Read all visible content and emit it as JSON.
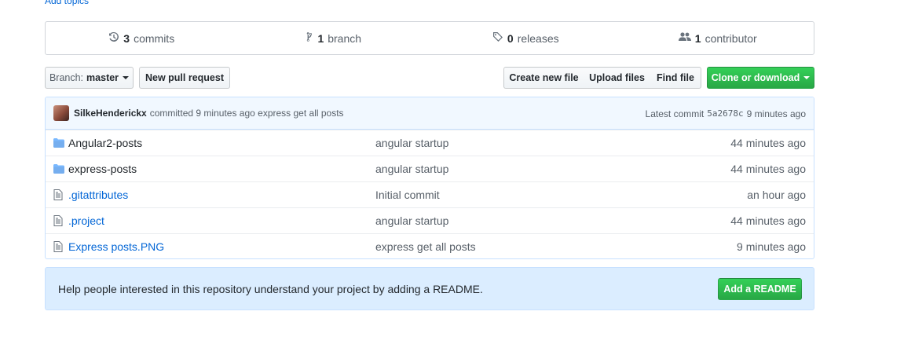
{
  "topics": {
    "add_label": "Add topics"
  },
  "summary": {
    "commits": {
      "count": "3",
      "label": "commits",
      "icon": "history-icon"
    },
    "branches": {
      "count": "1",
      "label": "branch",
      "icon": "branch-icon"
    },
    "releases": {
      "count": "0",
      "label": "releases",
      "icon": "tag-icon"
    },
    "contributors": {
      "count": "1",
      "label": "contributor",
      "icon": "people-icon"
    }
  },
  "toolbar": {
    "branch_prefix": "Branch:",
    "branch_name": "master",
    "new_pull_request": "New pull request",
    "create_new_file": "Create new file",
    "upload_files": "Upload files",
    "find_file": "Find file",
    "clone_or_download": "Clone or download"
  },
  "latest_commit": {
    "author": "SilkeHenderickx",
    "action": "committed",
    "time": "9 minutes ago",
    "message": "express get all posts",
    "latest_label": "Latest commit",
    "sha": "5a2678c",
    "sha_time": "9 minutes ago"
  },
  "files": [
    {
      "type": "dir",
      "icon": "folder-icon",
      "name": "Angular2-posts",
      "message": "angular startup",
      "age": "44 minutes ago"
    },
    {
      "type": "dir",
      "icon": "folder-icon",
      "name": "express-posts",
      "message": "angular startup",
      "age": "44 minutes ago"
    },
    {
      "type": "file",
      "icon": "file-icon",
      "name": ".gitattributes",
      "message": "Initial commit",
      "age": "an hour ago"
    },
    {
      "type": "file",
      "icon": "file-icon",
      "name": ".project",
      "message": "angular startup",
      "age": "44 minutes ago"
    },
    {
      "type": "file",
      "icon": "file-icon",
      "name": "Express posts.PNG",
      "message": "express get all posts",
      "age": "9 minutes ago"
    }
  ],
  "readme": {
    "message": "Help people interested in this repository understand your project by adding a README.",
    "button": "Add a README"
  },
  "colors": {
    "accent_green": "#28a745",
    "link_blue": "#0366d6",
    "commit_bar_bg": "#f1f8ff",
    "readme_bg": "#dbedff"
  }
}
